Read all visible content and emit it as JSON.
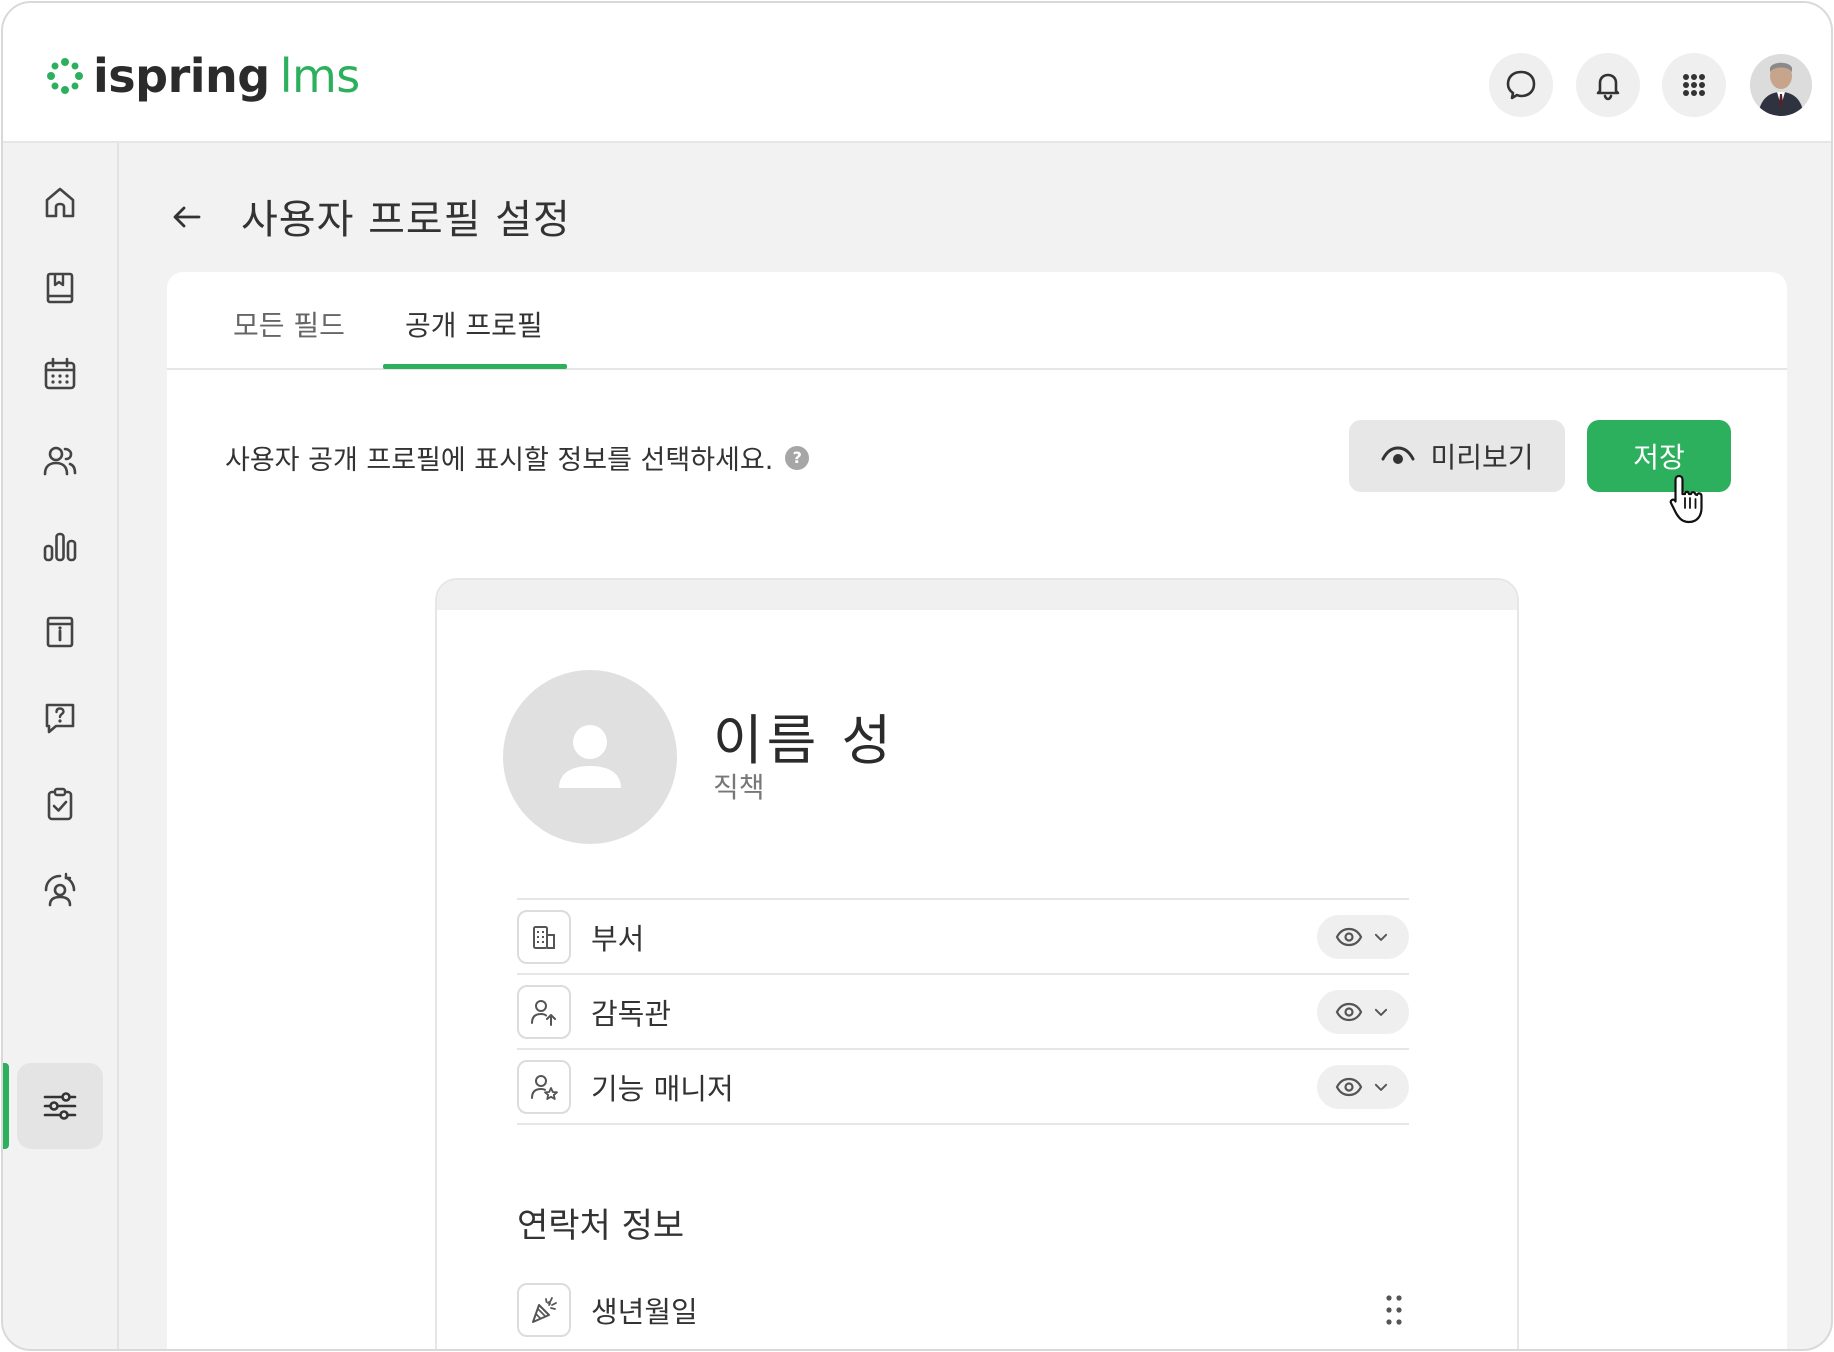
{
  "app": {
    "logo_word1": "ispring",
    "logo_word2": "lms",
    "brand_color": "#2db05e"
  },
  "header": {
    "icons": [
      "chat-icon",
      "bell-icon",
      "apps-grid-icon",
      "user-avatar"
    ]
  },
  "sidebar": {
    "items": [
      {
        "icon": "home-icon"
      },
      {
        "icon": "book-icon"
      },
      {
        "icon": "calendar-icon"
      },
      {
        "icon": "users-icon"
      },
      {
        "icon": "bar-chart-icon"
      },
      {
        "icon": "info-archive-icon"
      },
      {
        "icon": "question-chat-icon"
      },
      {
        "icon": "clipboard-check-icon"
      },
      {
        "icon": "user-sync-icon"
      },
      {
        "icon": "settings-sliders-icon",
        "active": true
      }
    ]
  },
  "page": {
    "title": "사용자 프로필 설정"
  },
  "tabs": [
    {
      "label": "모든 필드",
      "active": false
    },
    {
      "label": "공개 프로필",
      "active": true
    }
  ],
  "toolbar": {
    "description": "사용자 공개 프로필에 표시할 정보를 선택하세요.",
    "help": "?",
    "preview_label": "미리보기",
    "save_label": "저장"
  },
  "profile": {
    "name": "이름 성",
    "role": "직책",
    "fields": [
      {
        "label": "부서",
        "icon": "building-icon"
      },
      {
        "label": "감독관",
        "icon": "user-arrow-icon"
      },
      {
        "label": "기능 매니저",
        "icon": "user-star-icon"
      }
    ],
    "contact_section_title": "연락처 정보",
    "contact_fields": [
      {
        "label": "생년월일",
        "icon": "party-icon"
      }
    ]
  }
}
